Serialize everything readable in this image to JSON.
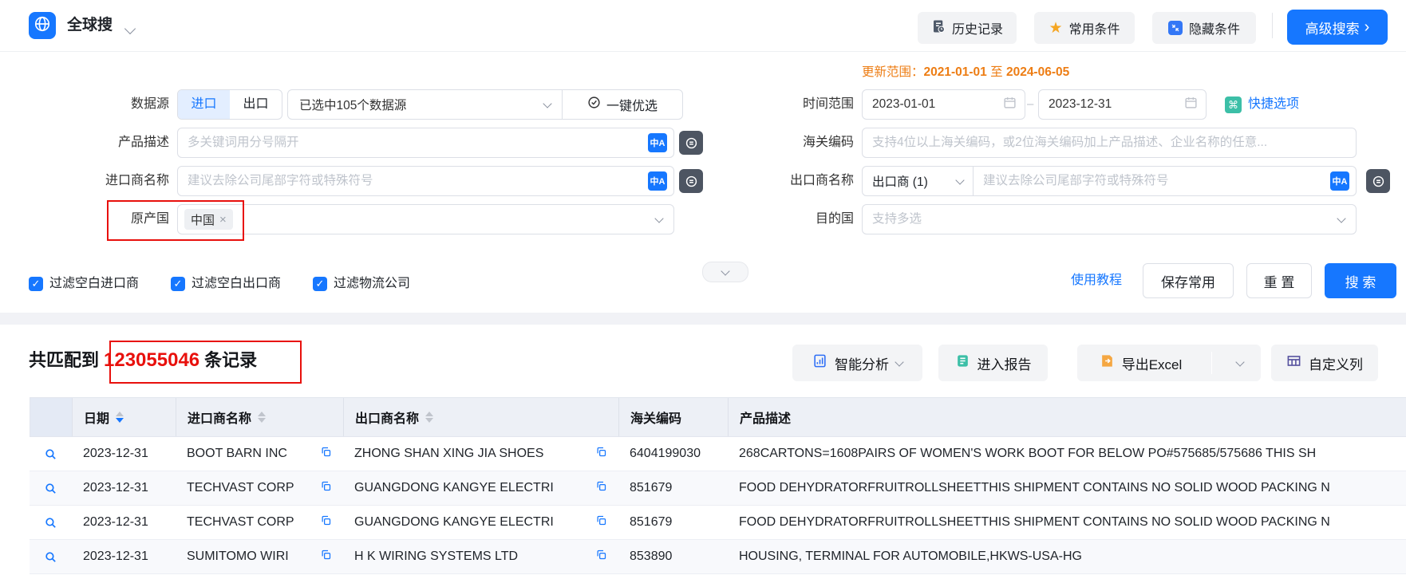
{
  "topbar": {
    "app_title": "全球搜",
    "history_btn": "历史记录",
    "favorites_btn": "常用条件",
    "hide_btn": "隐藏条件",
    "advanced_btn": "高级搜索"
  },
  "form": {
    "update_label": "更新范围：",
    "update_from": "2021-01-01",
    "update_word": "至",
    "update_to": "2024-06-05",
    "datasource_label": "数据源",
    "import_tab": "进口",
    "export_tab": "出口",
    "datasource_selected": "已选中105个数据源",
    "optimize_btn": "一键优选",
    "time_label": "时间范围",
    "date_start": "2023-01-01",
    "date_end": "2023-12-31",
    "quick_options": "快捷选项",
    "product_label": "产品描述",
    "product_placeholder": "多关键词用分号隔开",
    "hs_label": "海关编码",
    "hs_placeholder": "支持4位以上海关编码，或2位海关编码加上产品描述、企业名称的任意...",
    "importer_label": "进口商名称",
    "importer_placeholder": "建议去除公司尾部字符或特殊符号",
    "exporter_label": "出口商名称",
    "exporter_select": "出口商 (1)",
    "exporter_placeholder": "建议去除公司尾部字符或特殊符号",
    "origin_label": "原产国",
    "origin_tag": "中国",
    "dest_label": "目的国",
    "dest_placeholder": "支持多选",
    "filter_importer": "过滤空白进口商",
    "filter_exporter": "过滤空白出口商",
    "filter_logistics": "过滤物流公司",
    "tutorial_link": "使用教程",
    "save_btn": "保存常用",
    "reset_btn": "重 置",
    "search_btn": "搜 索"
  },
  "results": {
    "match_prefix": "共匹配到",
    "match_count": "123055046",
    "match_suffix": "条记录",
    "analysis_btn": "智能分析",
    "report_btn": "进入报告",
    "export_btn": "导出Excel",
    "columns_btn": "自定义列",
    "table": {
      "headers": {
        "date": "日期",
        "importer": "进口商名称",
        "exporter": "出口商名称",
        "hs": "海关编码",
        "desc": "产品描述"
      },
      "rows": [
        {
          "date": "2023-12-31",
          "importer": "BOOT BARN INC",
          "exporter": "ZHONG SHAN XING JIA SHOES",
          "hs": "6404199030",
          "desc": "268CARTONS=1608PAIRS OF WOMEN'S WORK BOOT FOR BELOW PO#575685/575686 THIS SH"
        },
        {
          "date": "2023-12-31",
          "importer": "TECHVAST CORP",
          "exporter": "GUANGDONG KANGYE ELECTRI",
          "hs": "851679",
          "desc": "FOOD DEHYDRATORFRUITROLLSHEETTHIS SHIPMENT CONTAINS NO SOLID WOOD PACKING N"
        },
        {
          "date": "2023-12-31",
          "importer": "TECHVAST CORP",
          "exporter": "GUANGDONG KANGYE ELECTRI",
          "hs": "851679",
          "desc": "FOOD DEHYDRATORFRUITROLLSHEETTHIS SHIPMENT CONTAINS NO SOLID WOOD PACKING N"
        },
        {
          "date": "2023-12-31",
          "importer": "SUMITOMO WIRI",
          "exporter": "H K WIRING SYSTEMS LTD",
          "hs": "853890",
          "desc": "HOUSING, TERMINAL FOR AUTOMOBILE,HKWS-USA-HG"
        }
      ]
    }
  },
  "glyphs": {
    "command": "⌘",
    "translate": "中A",
    "close": "×",
    "check": "✓",
    "chevron_right": "›",
    "dash": "–",
    "star": "★"
  },
  "colors": {
    "primary_blue": "#1677ff",
    "orange": "#ed7d14",
    "annotation_red": "#e8100c",
    "teal": "#3cbfa7",
    "gold": "#f5a623"
  }
}
